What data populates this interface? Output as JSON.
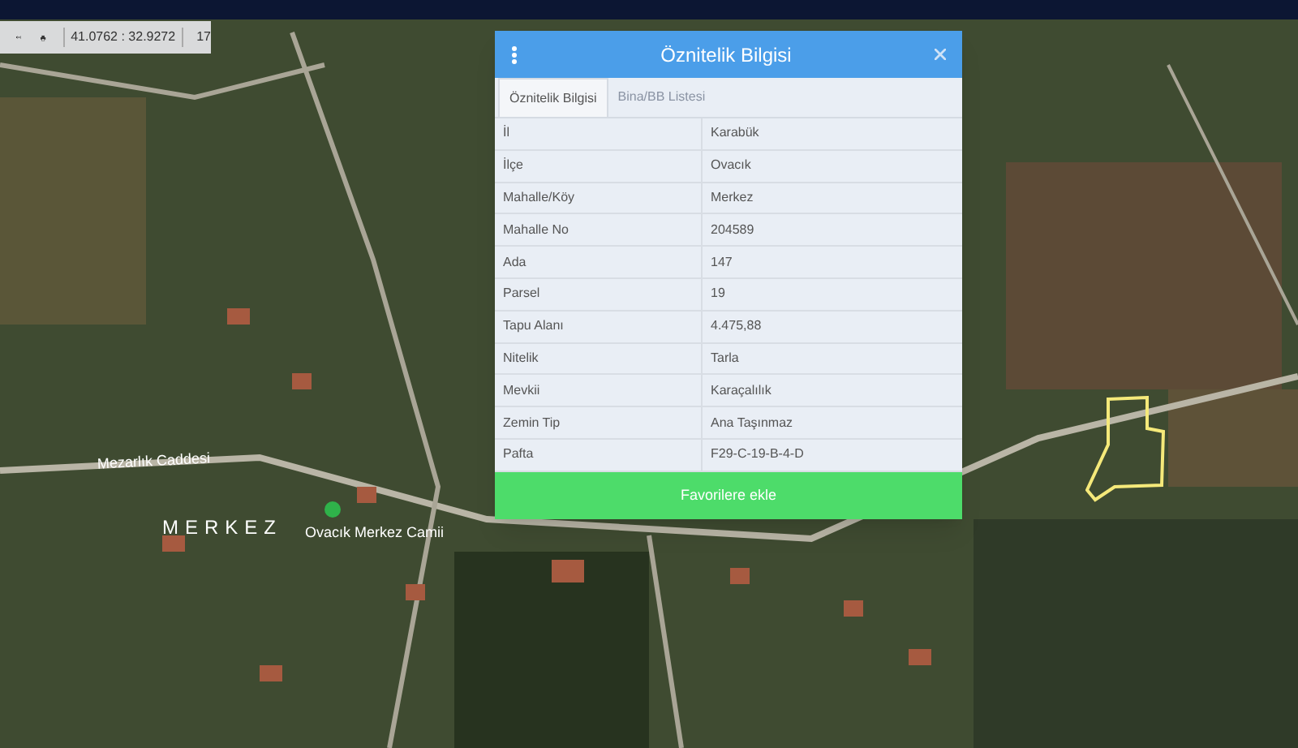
{
  "toolbar": {
    "coordinates": "41.0762 : 32.9272",
    "zoom": "17"
  },
  "map_labels": [
    {
      "kind": "street",
      "text": "Mezarlık Caddesi"
    },
    {
      "kind": "district",
      "text": "MERKEZ"
    },
    {
      "kind": "poi",
      "text": "Ovacık Merkez Camii"
    }
  ],
  "dialog": {
    "title": "Öznitelik Bilgisi",
    "tabs": [
      {
        "label": "Öznitelik Bilgisi",
        "selected": true
      },
      {
        "label": "Bina/BB Listesi",
        "selected": false
      }
    ],
    "rows": [
      {
        "label": "İl",
        "value": "Karabük"
      },
      {
        "label": "İlçe",
        "value": "Ovacık"
      },
      {
        "label": "Mahalle/Köy",
        "value": "Merkez"
      },
      {
        "label": "Mahalle No",
        "value": "204589"
      },
      {
        "label": "Ada",
        "value": "147"
      },
      {
        "label": "Parsel",
        "value": "19"
      },
      {
        "label": "Tapu Alanı",
        "value": "4.475,88"
      },
      {
        "label": "Nitelik",
        "value": "Tarla"
      },
      {
        "label": "Mevkii",
        "value": "Karaçalılık"
      },
      {
        "label": "Zemin Tip",
        "value": "Ana Taşınmaz"
      },
      {
        "label": "Pafta",
        "value": "F29-C-19-B-4-D"
      }
    ],
    "button": "Favorilere ekle"
  }
}
